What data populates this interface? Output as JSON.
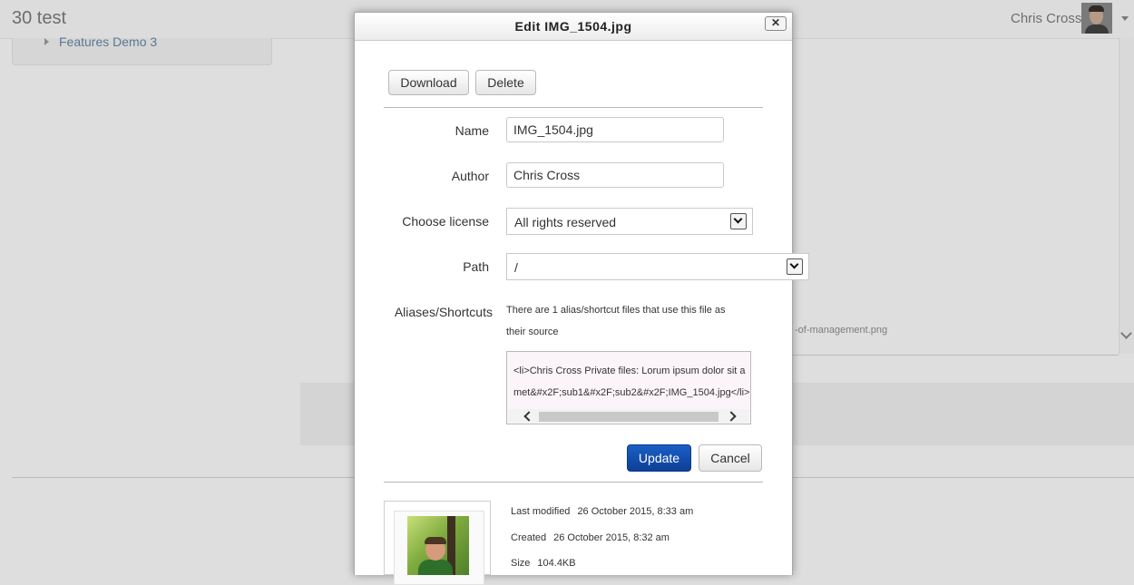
{
  "background": {
    "site_name": "30 test",
    "user_name": "Chris Cross",
    "nav_link": "Features Demo 3",
    "file_fragment": "-of-management.png"
  },
  "dialog": {
    "title": "Edit IMG_1504.jpg",
    "close_glyph": "✕",
    "toolbar": {
      "download_label": "Download",
      "delete_label": "Delete"
    },
    "fields": {
      "name_label": "Name",
      "name_value": "IMG_1504.jpg",
      "author_label": "Author",
      "author_value": "Chris Cross",
      "license_label": "Choose license",
      "license_value": "All rights reserved",
      "path_label": "Path",
      "path_value": "/"
    },
    "aliases": {
      "label": "Aliases/Shortcuts",
      "description": "There are 1 alias/shortcut files that use this file as their source",
      "item": "<li>Chris Cross Private files: Lorum ipsum dolor sit amet&#x2F;sub1&#x2F;sub2&#x2F;IMG_1504.jpg</li>"
    },
    "actions": {
      "update_label": "Update",
      "cancel_label": "Cancel"
    },
    "info": {
      "last_modified_label": "Last modified",
      "last_modified_value": "26 October 2015, 8:33 am",
      "created_label": "Created",
      "created_value": "26 October 2015, 8:32 am",
      "size_label": "Size",
      "size_value": "104.4KB"
    }
  },
  "colors": {
    "primary_button": "#0e3f95",
    "overlay": "#dedede",
    "link": "#5b7791"
  },
  "icons": [
    "user-avatar",
    "dropdown-caret-icon",
    "close-icon",
    "select-arrow-icon",
    "scroll-left-icon",
    "scroll-right-icon",
    "file-thumbnail"
  ]
}
